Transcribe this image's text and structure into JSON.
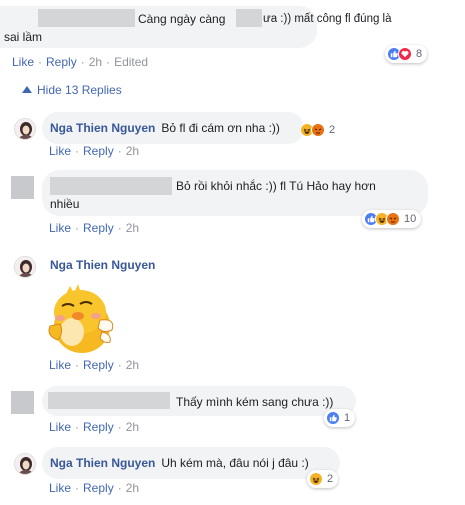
{
  "comments": [
    {
      "text_line1": "Càng ngày càng ",
      "text_line1_b": "ưa :)) mất công fl đúng là",
      "text_line2": "sai lầm",
      "like": "Like",
      "reply": "Reply",
      "time": "2h",
      "edited": "Edited",
      "reaction_count": "8"
    }
  ],
  "hide_replies": "Hide 13 Replies",
  "replies": [
    {
      "author": "Nga Thien Nguyen",
      "text": "Bỏ fl đi cám ơn nha :))",
      "like": "Like",
      "reply": "Reply",
      "time": "2h",
      "reaction_count": "2"
    },
    {
      "text_line1": "Bỏ rồi khỏi nhắc :)) fl Tú Hảo hay hơn",
      "text_line2": "nhiều",
      "like": "Like",
      "reply": "Reply",
      "time": "2h",
      "reaction_count": "10"
    },
    {
      "author": "Nga Thien Nguyen",
      "sticker": "chick-sticker",
      "like": "Like",
      "reply": "Reply",
      "time": "2h"
    },
    {
      "text": "Thấy mình kém sang chưa :))",
      "like": "Like",
      "reply": "Reply",
      "time": "2h",
      "reaction_count": "1"
    },
    {
      "author": "Nga Thien Nguyen",
      "text": "Uh kém mà, đâu nói j đâu :)",
      "like": "Like",
      "reply": "Reply",
      "time": "2h",
      "reaction_count": "2"
    }
  ],
  "colors": {
    "link": "#4267b2",
    "author": "#385898",
    "bubble": "#f2f3f5",
    "like_blue": "#4c7ef3",
    "love_red": "#f0284a",
    "haha_yellow": "#f7b125",
    "angry_orange": "#e9710f"
  }
}
